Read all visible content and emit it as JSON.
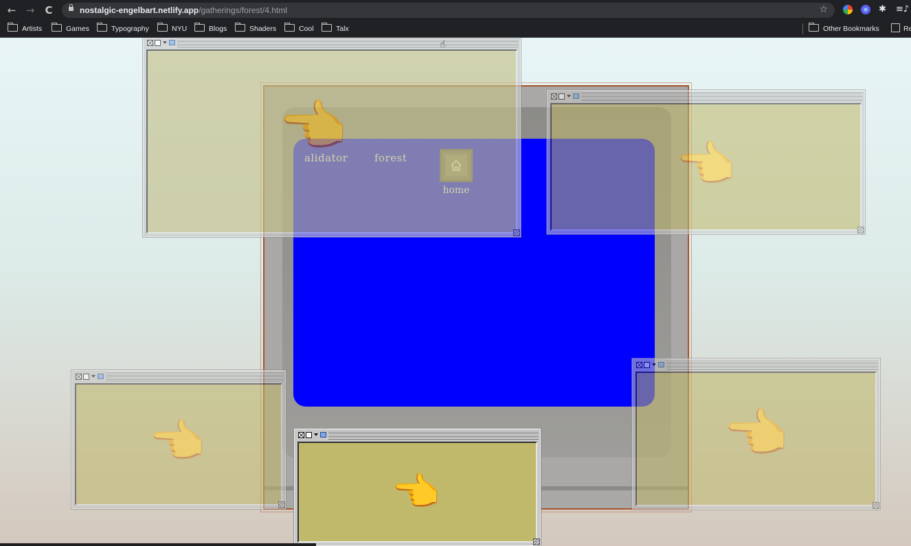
{
  "browser": {
    "url_host": "nostalgic-engelbart.netlify.app",
    "url_path": "/gatherings/forest/4.html",
    "nav": {
      "back": "←",
      "forward": "→",
      "reload": "C"
    },
    "star_icon": "☆",
    "bookmarks": [
      "Artists",
      "Games",
      "Typography",
      "NYU",
      "Blogs",
      "Shaders",
      "Cool",
      "Talx"
    ],
    "other_bookmarks": "Other Bookmarks",
    "reading_list": "Re"
  },
  "page": {
    "title_left": "alidator",
    "title_right": "forest",
    "home_label": "home",
    "hand_glyph": "👈",
    "colors": {
      "screen": "#0000ff",
      "window_fill": "#c0b86a",
      "crt_border": "#a8532c",
      "title_text": "#f2f2f2"
    }
  }
}
